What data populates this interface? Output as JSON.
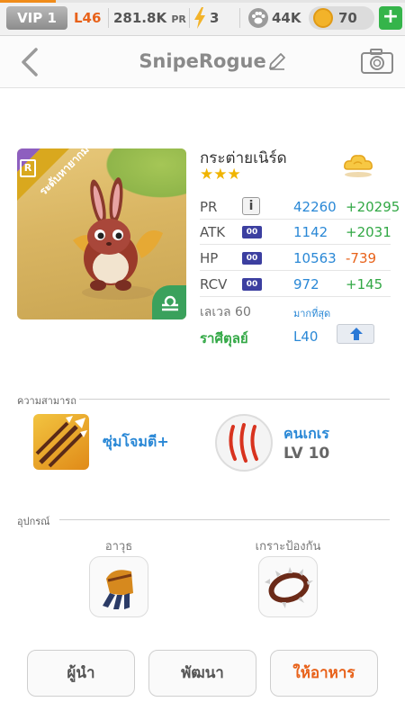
{
  "status_bar": {
    "vip": "VIP 1",
    "level": "L46",
    "pr": "281.8K",
    "pr_suffix": "PR",
    "energy": "3",
    "paw": "44K",
    "coins": "70",
    "plus_label": "+"
  },
  "header": {
    "title": "SnipeRogue"
  },
  "pet": {
    "rank_badge": "R",
    "ribbon": "ระดับหายากมาก",
    "name": "กระต่ายเนิร์ด",
    "stars": "★★★",
    "stats": [
      {
        "label": "PR",
        "icon": "i",
        "value": "42260",
        "bonus": "+20295",
        "bonus_type": "positive"
      },
      {
        "label": "ATK",
        "icon": "00",
        "value": "1142",
        "bonus": "+2031",
        "bonus_type": "positive"
      },
      {
        "label": "HP",
        "icon": "00",
        "value": "10563",
        "bonus": "-739",
        "bonus_type": "negative"
      },
      {
        "label": "RCV",
        "icon": "00",
        "value": "972",
        "bonus": "+145",
        "bonus_type": "positive"
      }
    ],
    "level_label": "เลเวล 60",
    "level_max": "มากที่สุด",
    "zodiac_label": "ราศีตุลย์",
    "zodiac_level": "L40"
  },
  "abilities": {
    "section_title": "ความสามารถ",
    "skill_name": "ซุ่มโจมตี+",
    "trait_name": "คนเกเร",
    "trait_level": "LV 10"
  },
  "equipment": {
    "section_title": "อุปกรณ์",
    "weapon_label": "อาวุธ",
    "armor_label": "เกราะป้องกัน"
  },
  "buttons": {
    "leader": "ผู้นำ",
    "evolve": "พัฒนา",
    "feed": "ให้อาหาร"
  },
  "colors": {
    "accent_blue": "#2a88d6",
    "positive_green": "#32a845",
    "negative_orange": "#e8621a",
    "energy_fill": "#f08c1a"
  },
  "icons": [
    "back-icon",
    "pencil-icon",
    "camera-icon",
    "lightning-icon",
    "paw-icon",
    "coin-icon",
    "plus-icon",
    "cloud-icon",
    "info-icon",
    "up-arrow-icon",
    "libra-icon",
    "claw-icon",
    "spear-icon",
    "gauntlet-icon",
    "collar-icon"
  ]
}
